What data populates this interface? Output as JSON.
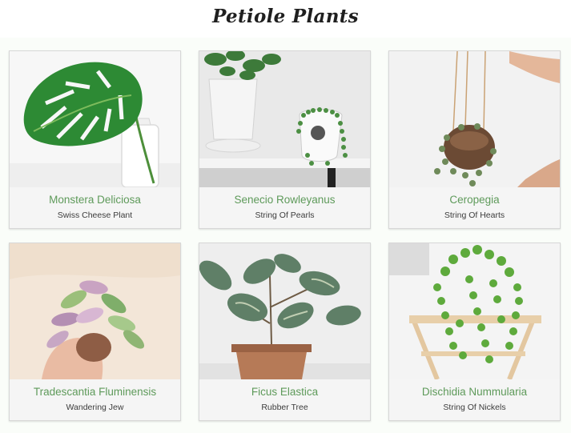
{
  "header": {
    "title": "Petiole Plants"
  },
  "plants": [
    {
      "name": "Monstera Deliciosa",
      "common_name": "Swiss Cheese Plant",
      "image": "monstera-leaf-photo"
    },
    {
      "name": "Senecio Rowleyanus",
      "common_name": "String Of Pearls",
      "image": "string-of-pearls-photo"
    },
    {
      "name": "Ceropegia",
      "common_name": "String Of Hearts",
      "image": "string-of-hearts-photo"
    },
    {
      "name": "Tradescantia Fluminensis",
      "common_name": "Wandering Jew",
      "image": "tradescantia-photo"
    },
    {
      "name": "Ficus Elastica",
      "common_name": "Rubber Tree",
      "image": "rubber-tree-photo"
    },
    {
      "name": "Dischidia Nummularia",
      "common_name": "String Of Nickels",
      "image": "string-of-nickels-photo"
    }
  ]
}
